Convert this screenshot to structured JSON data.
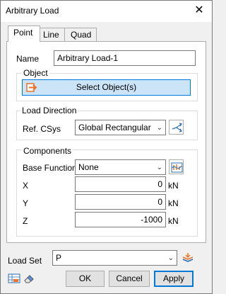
{
  "window": {
    "title": "Arbitrary Load",
    "close_glyph": "✕"
  },
  "tabs": [
    {
      "label": "Point",
      "active": true
    },
    {
      "label": "Line",
      "active": false
    },
    {
      "label": "Quad",
      "active": false
    }
  ],
  "name": {
    "label": "Name",
    "value": "Arbitrary Load-1"
  },
  "object": {
    "legend": "Object",
    "select_button": "Select Object(s)",
    "icon": "arrow-right-icon"
  },
  "load_direction": {
    "legend": "Load Direction",
    "label": "Ref. CSys",
    "value": "Global Rectangular",
    "icon": "coordinate-system-icon"
  },
  "components": {
    "legend": "Components",
    "base_function": {
      "label": "Base Function",
      "value": "None",
      "icon": "function-graph-icon"
    },
    "x": {
      "label": "X",
      "value": "0",
      "unit": "kN"
    },
    "y": {
      "label": "Y",
      "value": "0",
      "unit": "kN"
    },
    "z": {
      "label": "Z",
      "value": "-1000",
      "unit": "kN"
    }
  },
  "load_set": {
    "label": "Load Set",
    "value": "P",
    "icon": "load-set-icon"
  },
  "footer": {
    "ok": "OK",
    "cancel": "Cancel",
    "apply": "Apply",
    "left_icons": [
      "table-icon",
      "eraser-icon"
    ]
  },
  "colors": {
    "accent": "#0078d7",
    "select_bg": "#cce4f7",
    "icon_orange": "#e8752a"
  }
}
